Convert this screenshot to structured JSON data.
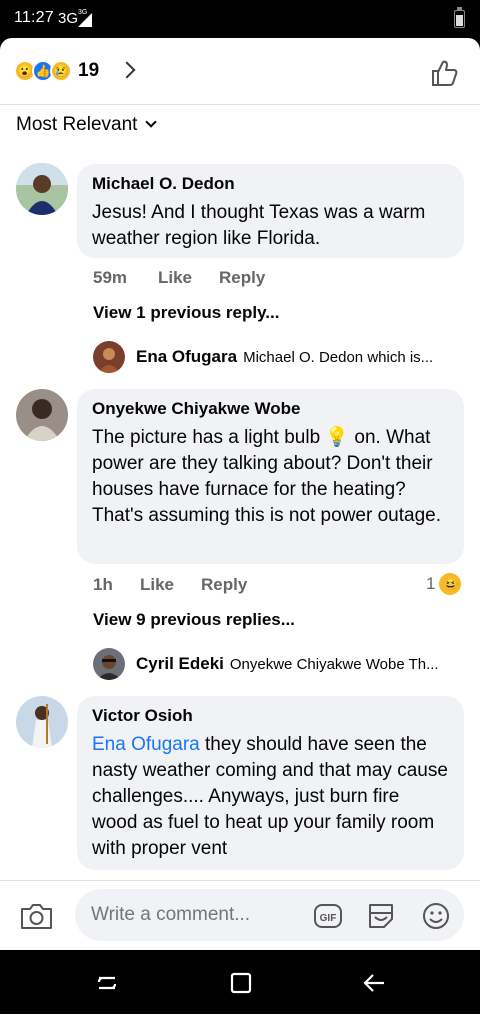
{
  "status": {
    "time": "11:27",
    "network": "3G",
    "network_sup": "3G"
  },
  "header": {
    "reaction_icons": [
      "wow-reaction-icon",
      "like-reaction-icon",
      "sad-reaction-icon"
    ],
    "reaction_count": "19"
  },
  "sort": {
    "label": "Most Relevant"
  },
  "comments": [
    {
      "author": "Michael O. Dedon",
      "text": "Jesus! And I thought Texas was a warm weather region like Florida.",
      "time": "59m",
      "like": "Like",
      "reply": "Reply",
      "view_previous": "View 1 previous reply...",
      "reply_preview": {
        "name": "Ena Ofugara",
        "snippet": "Michael O. Dedon which is..."
      }
    },
    {
      "author": "Onyekwe Chiyakwe Wobe",
      "text_1": "The picture has a light bulb ",
      "text_2": " on. What power are they talking about? Don't their houses have furnace for the heating? That's assuming this is not power outage.",
      "time": "1h",
      "like": "Like",
      "reply": "Reply",
      "reaction_count": "1",
      "view_previous": "View 9 previous replies...",
      "reply_preview": {
        "name": "Cyril Edeki",
        "snippet": "Onyekwe Chiyakwe Wobe Th..."
      }
    },
    {
      "author": "Victor Osioh",
      "mention": "Ena Ofugara",
      "text": " they should have seen the nasty weather coming and that may cause challenges.... Anyways, just burn fire wood as fuel to heat up your family room with proper vent"
    }
  ],
  "composer": {
    "placeholder": "Write a comment...",
    "gif": "GIF"
  },
  "colors": {
    "link": "#1877f2",
    "bubble": "#f0f2f5",
    "meta": "#65676b"
  }
}
